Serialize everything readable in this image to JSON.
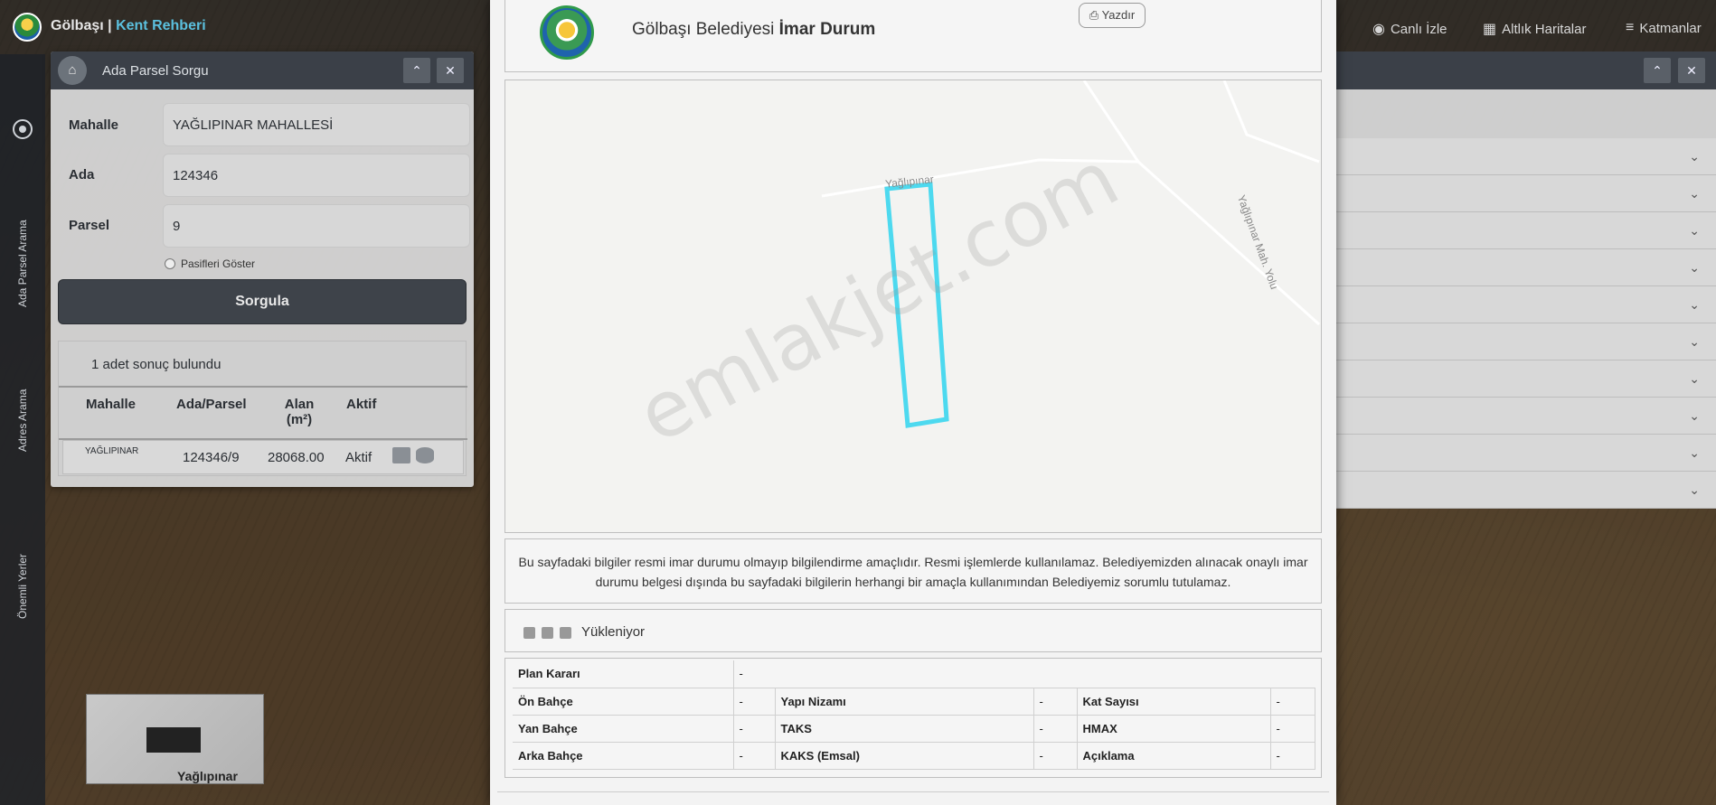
{
  "app": {
    "title_main": "Gölbaşı",
    "title_sep": " | ",
    "title_sub": "Kent Rehberi"
  },
  "topnav": {
    "live": "Canlı İzle",
    "base_maps": "Altlık Haritalar",
    "layers": "Katmanlar"
  },
  "left_rail": {
    "parcel_search": "Ada Parsel Arama",
    "address_search": "Adres Arama",
    "important_places": "Önemli Yerler"
  },
  "query_panel": {
    "title": "Ada Parsel Sorgu",
    "collapse": "⌃",
    "close": "✕",
    "fields": {
      "mahalle_label": "Mahalle",
      "mahalle_value": "YAĞLIPINAR MAHALLESİ",
      "ada_label": "Ada",
      "ada_value": "124346",
      "parsel_label": "Parsel",
      "parsel_value": "9"
    },
    "show_passive": "Pasifleri Göster",
    "query_button": "Sorgula",
    "result_count": "1 adet sonuç bulundu",
    "columns": {
      "mahalle": "Mahalle",
      "ada_parsel": "Ada/Parsel",
      "alan": "Alan",
      "alan_unit": "(m²)",
      "aktif": "Aktif"
    },
    "row": {
      "mahalle": "YAĞLIPINAR",
      "ada_parsel": "124346/9",
      "alan": "28068.00",
      "aktif": "Aktif"
    }
  },
  "minimap": {
    "label": "Yağlıpınar"
  },
  "modal": {
    "title_prefix": "Gölbaşı Belediyesi ",
    "title_bold": "İmar Durum",
    "print": "Yazdır",
    "map": {
      "road_label_1": "Yağlıpınar",
      "road_label_2": "Yağlıpınar Mah. Yolu",
      "watermark": "emlakjet.com",
      "parcel_color": "#4dd9ef"
    },
    "disclaimer": "Bu sayfadaki bilgiler resmi imar durumu olmayıp bilgilendirme amaçlıdır. Resmi işlemlerde kullanılamaz. Belediyemizden alınacak onaylı imar durumu belgesi dışında bu sayfadaki bilgilerin herhangi bir amaçla kullanımından Belediyemiz sorumlu tutulamaz.",
    "loading": "Yükleniyor",
    "table": {
      "plan_karari_label": "Plan Kararı",
      "plan_karari_value": "-",
      "on_bahce_label": "Ön Bahçe",
      "on_bahce_value": "-",
      "yapi_nizami_label": "Yapı Nizamı",
      "yapi_nizami_value": "-",
      "kat_sayisi_label": "Kat Sayısı",
      "kat_sayisi_value": "-",
      "yan_bahce_label": "Yan Bahçe",
      "yan_bahce_value": "-",
      "taks_label": "TAKS",
      "taks_value": "-",
      "hmax_label": "HMAX",
      "hmax_value": "-",
      "arka_bahce_label": "Arka Bahçe",
      "arka_bahce_value": "-",
      "kaks_label": "KAKS (Emsal)",
      "kaks_value": "-",
      "aciklama_label": "Açıklama",
      "aciklama_value": "-"
    }
  }
}
